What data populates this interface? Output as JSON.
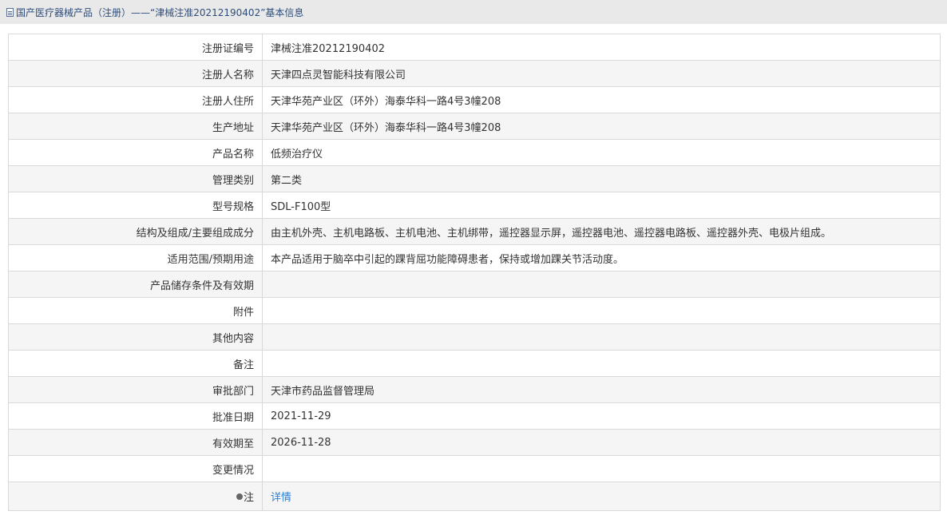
{
  "header": {
    "icon": "document-icon",
    "title": "国产医疗器械产品（注册）——“津械注准20212190402”基本信息"
  },
  "rows": [
    {
      "label": "注册证编号",
      "value": "津械注准20212190402"
    },
    {
      "label": "注册人名称",
      "value": "天津四点灵智能科技有限公司"
    },
    {
      "label": "注册人住所",
      "value": "天津华苑产业区（环外）海泰华科一路4号3幢208"
    },
    {
      "label": "生产地址",
      "value": "天津华苑产业区（环外）海泰华科一路4号3幢208"
    },
    {
      "label": "产品名称",
      "value": "低频治疗仪"
    },
    {
      "label": "管理类别",
      "value": "第二类"
    },
    {
      "label": "型号规格",
      "value": "SDL-F100型"
    },
    {
      "label": "结构及组成/主要组成成分",
      "value": "由主机外壳、主机电路板、主机电池、主机绑带，遥控器显示屏，遥控器电池、遥控器电路板、遥控器外壳、电极片组成。"
    },
    {
      "label": "适用范围/预期用途",
      "value": "本产品适用于脑卒中引起的踝背屈功能障碍患者，保持或增加踝关节活动度。"
    },
    {
      "label": "产品储存条件及有效期",
      "value": ""
    },
    {
      "label": "附件",
      "value": ""
    },
    {
      "label": "其他内容",
      "value": ""
    },
    {
      "label": "备注",
      "value": ""
    },
    {
      "label": "审批部门",
      "value": "天津市药品监督管理局"
    },
    {
      "label": "批准日期",
      "value": "2021-11-29"
    },
    {
      "label": "有效期至",
      "value": "2026-11-28"
    },
    {
      "label": "变更情况",
      "value": ""
    }
  ],
  "note": {
    "icon": "lightbulb-icon",
    "label": "注",
    "link": "详情"
  },
  "colors": {
    "header_bg": "#e9e9e9",
    "header_text": "#2e4d7b",
    "alt_row": "#f5f5f5",
    "border": "#d9d9d9",
    "link": "#2a7fd4"
  }
}
